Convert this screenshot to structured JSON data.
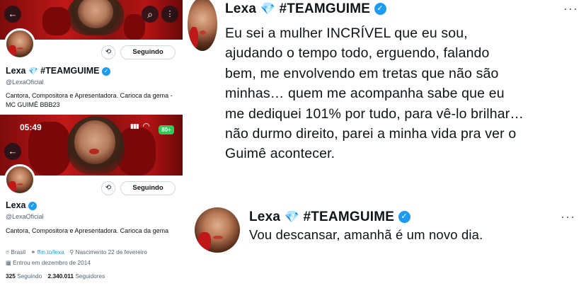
{
  "screen1": {
    "back_icon": "←",
    "search_icon": "⌕",
    "following_label": "Seguindo",
    "name": "Lexa",
    "diamond": "💎",
    "hashtag": "#TEAMGUIME",
    "handle": "@LexaOficial",
    "bio": "Cantora, Compositora e Apresentadora. Carioca da gema - MC GUIMÊ BBB23"
  },
  "screen2": {
    "time": "05:49",
    "signal": "▮▮▮",
    "wifi": "◠",
    "battery": "80+",
    "back_icon": "←",
    "following_label": "Seguindo",
    "name": "Lexa",
    "handle": "@LexaOficial",
    "bio": "Cantora, Compositora e Apresentadora. Carioca da gema",
    "location": "Brasil",
    "link": "ffm.to/lexa",
    "birthday": "Nascimento 22 de fevereiro",
    "joined": "Entrou em dezembro de 2014",
    "following_count": "325",
    "following_text": "Seguindo",
    "followers_count": "2.340.011",
    "followers_text": "Seguidores"
  },
  "tweet1": {
    "name": "Lexa",
    "diamond": "💎",
    "hashtag": "#TEAMGUIME",
    "more": "···",
    "lines": [
      "Eu sei a mulher INCRÍVEL que eu sou,",
      "ajudando o tempo todo, erguendo, falando",
      "bem, me envolvendo em tretas que não são",
      "minhas… quem me acompanha sabe que eu",
      "me dediquei 101% por tudo, para vê-lo brilhar…",
      "não durmo direito, parei a minha vida pra ver o",
      "Guimê acontecer."
    ]
  },
  "tweet2": {
    "name": "Lexa",
    "diamond": "💎",
    "hashtag": "#TEAMGUIME",
    "more": "···",
    "text": "Vou descansar, amanhã é um novo dia."
  },
  "colors": {
    "verified": "#1d9bf0",
    "banner_red": "#c01818",
    "secondary_text": "#536471"
  }
}
